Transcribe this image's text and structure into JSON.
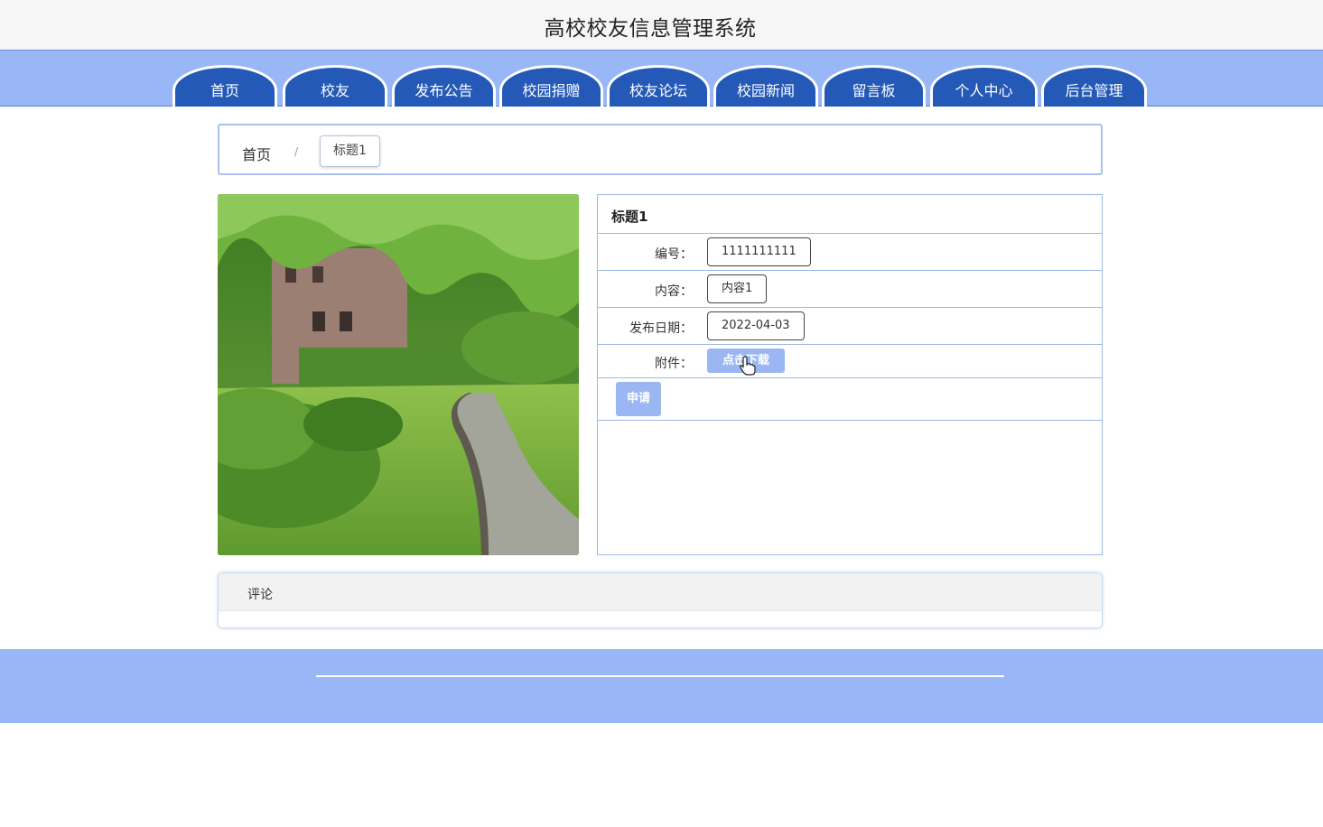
{
  "header": {
    "title": "高校校友信息管理系统"
  },
  "nav": {
    "items": [
      {
        "label": "首页"
      },
      {
        "label": "校友"
      },
      {
        "label": "发布公告"
      },
      {
        "label": "校园捐赠"
      },
      {
        "label": "校友论坛"
      },
      {
        "label": "校园新闻"
      },
      {
        "label": "留言板"
      },
      {
        "label": "个人中心"
      },
      {
        "label": "后台管理"
      }
    ]
  },
  "breadcrumb": {
    "home": "首页",
    "separator": "/",
    "current": "标题1"
  },
  "detail": {
    "title": "标题1",
    "fields": {
      "number_label": "编号：",
      "number_value": "1111111111",
      "content_label": "内容：",
      "content_value": "内容1",
      "date_label": "发布日期：",
      "date_value": "2022-04-03",
      "attachment_label": "附件："
    },
    "download_button": "点击下载",
    "apply_button": "申请"
  },
  "comments": {
    "title": "评论"
  },
  "colors": {
    "nav_bg": "#99b6f7",
    "tab_bg": "#2459b7",
    "button_bg": "#9ab7f3",
    "border": "#9cb8e2"
  }
}
